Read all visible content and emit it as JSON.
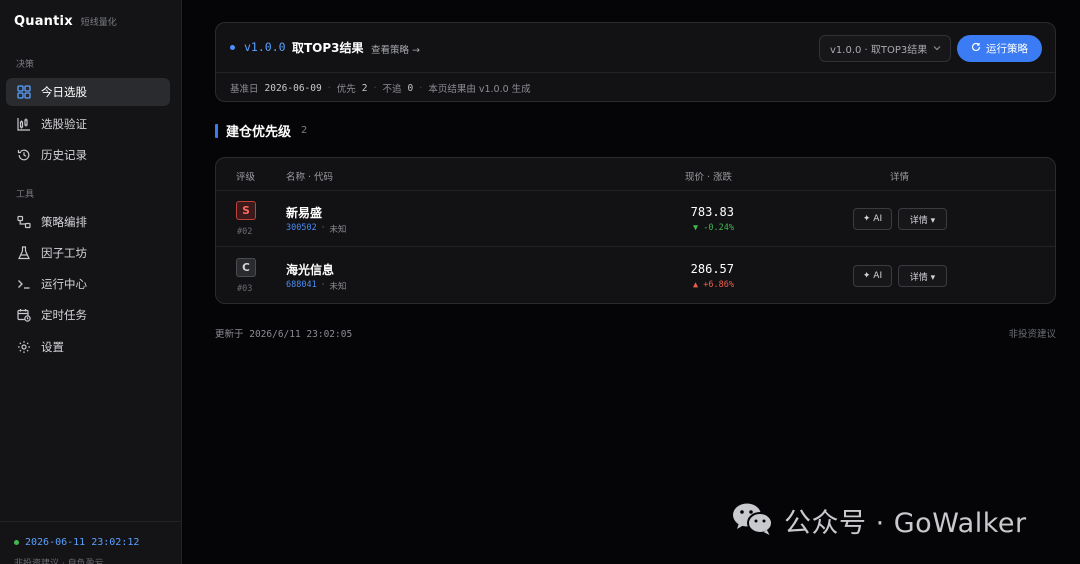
{
  "sidebar": {
    "brand": "Quantix",
    "brand_sub": "短线量化",
    "sections": [
      {
        "label": "决策",
        "items": [
          {
            "label": "今日选股",
            "icon": "grid-icon",
            "active": true
          },
          {
            "label": "选股验证",
            "icon": "chart-candle-icon"
          },
          {
            "label": "历史记录",
            "icon": "history-icon"
          }
        ]
      },
      {
        "label": "工具",
        "items": [
          {
            "label": "策略编排",
            "icon": "workflow-icon"
          },
          {
            "label": "因子工坊",
            "icon": "flask-icon"
          },
          {
            "label": "运行中心",
            "icon": "terminal-icon"
          },
          {
            "label": "定时任务",
            "icon": "calendar-clock-icon"
          },
          {
            "label": "设置",
            "icon": "gear-icon"
          }
        ]
      }
    ],
    "footer_time": "2026-06-11 23:02:12",
    "footer_note": "非投资建议 · 自负盈亏"
  },
  "strategy": {
    "version": "v1.0.0",
    "title": "取TOP3结果",
    "view_link": "查看策略 →",
    "select_value": "v1.0.0 · 取TOP3结果",
    "run_label": "运行策略",
    "meta": {
      "base_date_label": "基准日",
      "base_date": "2026-06-09",
      "priority_label": "优先",
      "priority": "2",
      "skip_label": "不追",
      "skip": "0",
      "note": "本页结果由 v1.0.0 生成"
    }
  },
  "section": {
    "title": "建仓优先级",
    "count": "2"
  },
  "table": {
    "headers": {
      "grade": "评级",
      "name": "名称 · 代码",
      "price": "现价 · 涨跌",
      "detail": "详情"
    },
    "rows": [
      {
        "grade": "S",
        "rank": "#02",
        "name": "新易盛",
        "code": "300502",
        "tag": "未知",
        "price": "783.83",
        "change": "▼ -0.24%",
        "direction": "down",
        "ai_label": "✦ AI",
        "detail_label": "详情 ▾"
      },
      {
        "grade": "C",
        "rank": "#03",
        "name": "海光信息",
        "code": "688041",
        "tag": "未知",
        "price": "286.57",
        "change": "▲ +6.86%",
        "direction": "up",
        "ai_label": "✦ AI",
        "detail_label": "详情 ▾"
      }
    ]
  },
  "footer": {
    "updated": "更新于 2026/6/11 23:02:05",
    "disclaimer": "非投资建议"
  },
  "watermark": {
    "text": "公众号 · GoWalker"
  }
}
